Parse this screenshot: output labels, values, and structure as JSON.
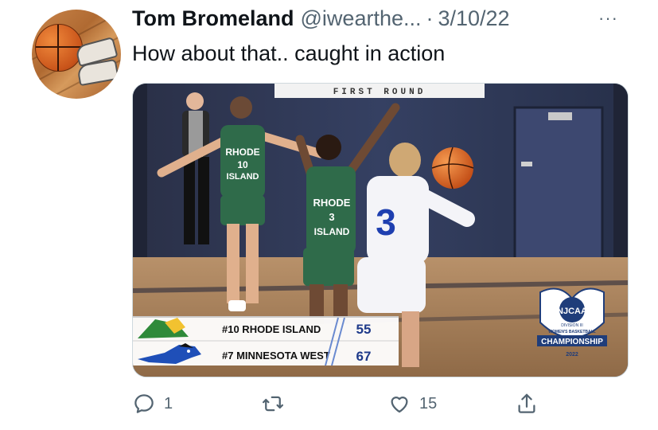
{
  "tweet": {
    "author_name": "Tom Bromeland",
    "handle": "@iwearthe...",
    "separator": "·",
    "date": "3/10/22",
    "more_label": "···",
    "text": "How about that.. caught in action"
  },
  "media": {
    "round_banner": "FIRST ROUND",
    "scoreboard": {
      "teams": [
        {
          "label": "#10 RHODE ISLAND",
          "score": "55"
        },
        {
          "label": "#7 MINNESOTA WEST",
          "score": "67"
        }
      ]
    },
    "jerseys": {
      "left_player": {
        "line1": "RHODE",
        "number": "10",
        "line2": "ISLAND"
      },
      "center_player": {
        "line1": "RHODE",
        "number": "3",
        "line2": "ISLAND"
      },
      "right_player": {
        "number": "3"
      }
    },
    "event_logo": {
      "brand": "NJCAA",
      "division": "DIVISION III",
      "subtitle": "WOMEN'S BASKETBALL",
      "title": "CHAMPIONSHIP",
      "year": "2022"
    }
  },
  "actions": {
    "reply_count": "1",
    "retweet_count": "",
    "like_count": "15"
  },
  "colors": {
    "text_primary": "#0f1419",
    "text_secondary": "#536471",
    "jersey_green": "#2f6b4a",
    "jersey_white": "#ffffff",
    "score_blue": "#1e3a8a"
  },
  "icons": [
    "reply-icon",
    "retweet-icon",
    "like-icon",
    "share-icon",
    "more-icon"
  ]
}
